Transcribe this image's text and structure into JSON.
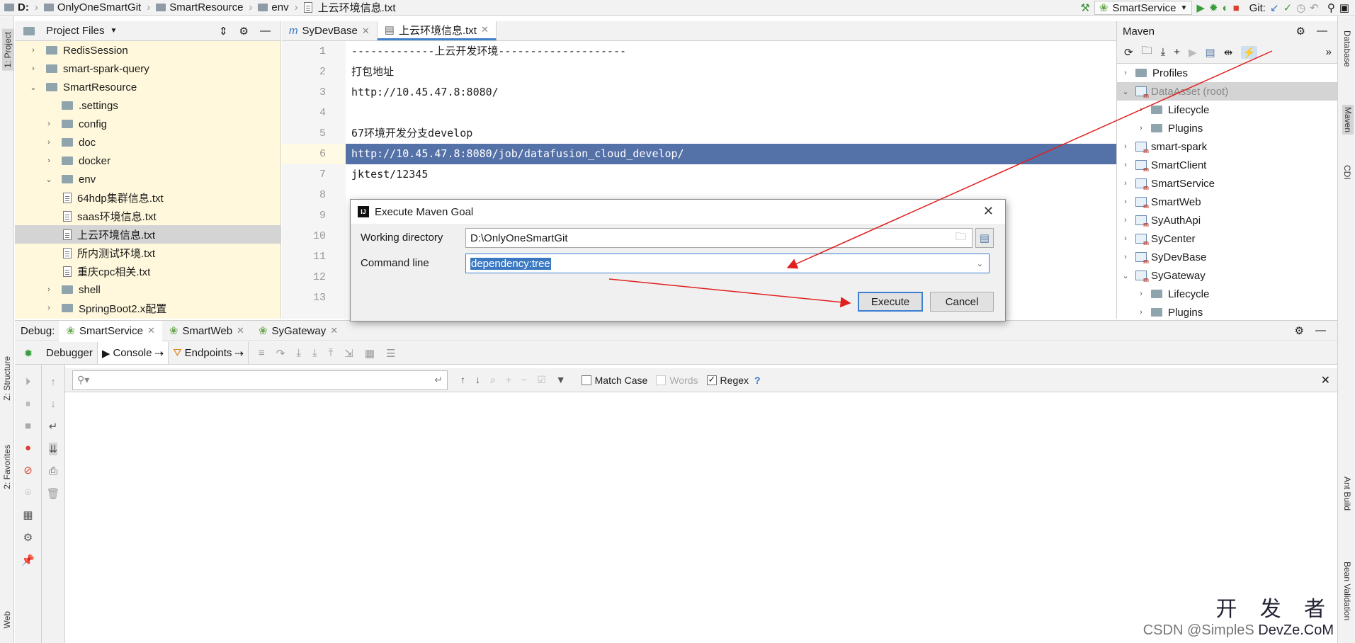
{
  "breadcrumb": [
    "D:",
    "OnlyOneSmartGit",
    "SmartResource",
    "env",
    "上云环境信息.txt"
  ],
  "toolbar": {
    "run_config": "SmartService",
    "git_label": "Git:"
  },
  "left_stripe": {
    "project": "1: Project",
    "structure": "Z: Structure",
    "favorites": "2: Favorites",
    "web": "Web"
  },
  "right_stripe": {
    "database": "Database",
    "maven": "Maven",
    "cdi": "CDI",
    "ant": "Ant Build",
    "bean": "Bean Validation"
  },
  "project": {
    "title": "Project Files",
    "items": [
      {
        "label": "RedisSession",
        "type": "folder",
        "depth": 1,
        "open": false
      },
      {
        "label": "smart-spark-query",
        "type": "folder",
        "depth": 1,
        "open": false
      },
      {
        "label": "SmartResource",
        "type": "folder",
        "depth": 1,
        "open": true
      },
      {
        "label": ".settings",
        "type": "folder",
        "depth": 2,
        "open": null
      },
      {
        "label": "config",
        "type": "folder",
        "depth": 2,
        "open": false
      },
      {
        "label": "doc",
        "type": "folder",
        "depth": 2,
        "open": false
      },
      {
        "label": "docker",
        "type": "folder",
        "depth": 2,
        "open": false
      },
      {
        "label": "env",
        "type": "folder",
        "depth": 2,
        "open": true
      },
      {
        "label": "64hdp集群信息.txt",
        "type": "file",
        "depth": 3
      },
      {
        "label": "saas环境信息.txt",
        "type": "file",
        "depth": 3
      },
      {
        "label": "上云环境信息.txt",
        "type": "file",
        "depth": 3,
        "selected": true
      },
      {
        "label": "所内测试环境.txt",
        "type": "file",
        "depth": 3
      },
      {
        "label": "重庆cpc相关.txt",
        "type": "file",
        "depth": 3
      },
      {
        "label": "shell",
        "type": "folder",
        "depth": 2,
        "open": false
      },
      {
        "label": "SpringBoot2.x配置",
        "type": "folder",
        "depth": 2,
        "open": false
      }
    ]
  },
  "editor": {
    "tabs": [
      {
        "label": "SyDevBase",
        "active": false
      },
      {
        "label": "上云环境信息.txt",
        "active": true
      }
    ],
    "line_numbers": [
      "1",
      "2",
      "3",
      "4",
      "5",
      "6",
      "7",
      "8",
      "9",
      "10",
      "11",
      "12",
      "13"
    ],
    "lines": [
      "-------------上云开发环境--------------------",
      "打包地址",
      "http://10.45.47.8:8080/",
      "",
      "67环境开发分支develop",
      "http://10.45.47.8:8080/job/datafusion_cloud_develop/",
      "jktest/12345",
      "",
      "",
      "",
      "",
      "",
      ""
    ]
  },
  "maven": {
    "title": "Maven",
    "items": [
      {
        "label": "Profiles",
        "depth": 0,
        "kind": "folder"
      },
      {
        "label": "DataAsset (root)",
        "depth": 0,
        "kind": "module",
        "selected": true,
        "open": true
      },
      {
        "label": "Lifecycle",
        "depth": 1,
        "kind": "folder"
      },
      {
        "label": "Plugins",
        "depth": 1,
        "kind": "folder"
      },
      {
        "label": "smart-spark",
        "depth": 0,
        "kind": "module"
      },
      {
        "label": "SmartClient",
        "depth": 0,
        "kind": "module"
      },
      {
        "label": "SmartService",
        "depth": 0,
        "kind": "module"
      },
      {
        "label": "SmartWeb",
        "depth": 0,
        "kind": "module"
      },
      {
        "label": "SyAuthApi",
        "depth": 0,
        "kind": "module"
      },
      {
        "label": "SyCenter",
        "depth": 0,
        "kind": "module"
      },
      {
        "label": "SyDevBase",
        "depth": 0,
        "kind": "module"
      },
      {
        "label": "SyGateway",
        "depth": 0,
        "kind": "module",
        "open": true
      },
      {
        "label": "Lifecycle",
        "depth": 1,
        "kind": "folder"
      },
      {
        "label": "Plugins",
        "depth": 1,
        "kind": "folder"
      }
    ]
  },
  "debug": {
    "label": "Debug:",
    "sessions": [
      "SmartService",
      "SmartWeb",
      "SyGateway"
    ],
    "subtabs": [
      "Debugger",
      "Console",
      "Endpoints"
    ],
    "search": {
      "match_case": "Match Case",
      "words": "Words",
      "regex": "Regex",
      "help": "?",
      "match_case_checked": false,
      "words_checked": false,
      "regex_checked": true
    }
  },
  "dialog": {
    "title": "Execute Maven Goal",
    "working_directory_label": "Working directory",
    "working_directory_value": "D:\\OnlyOneSmartGit",
    "command_line_label": "Command line",
    "command_line_value": "dependency:tree",
    "execute": "Execute",
    "cancel": "Cancel"
  },
  "watermark": {
    "logo": "开 发 者",
    "csdn": "CSDN @SimpleS",
    "devze": "DevZe.CoM"
  },
  "colors": {
    "selection": "#5471a8",
    "arrow": "#e02020",
    "project_bg": "#fff8dc",
    "accent": "#4083c9"
  }
}
